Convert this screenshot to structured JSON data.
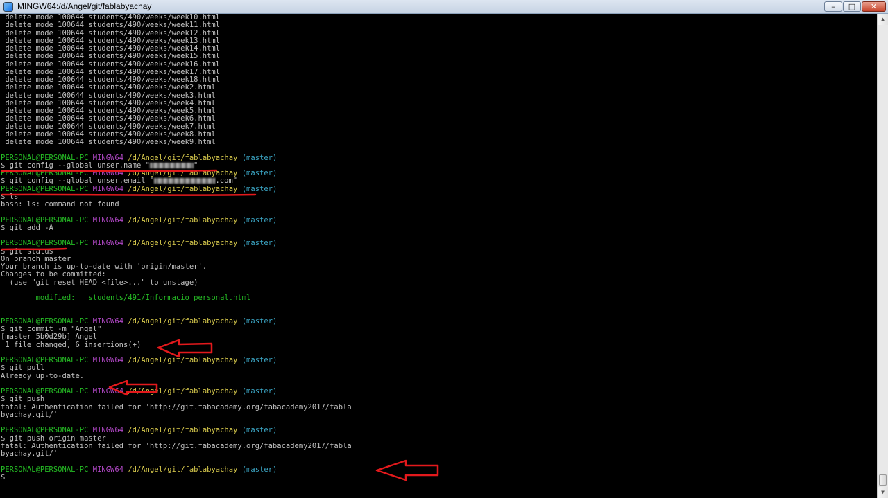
{
  "window": {
    "title": "MINGW64:/d/Angel/git/fablabyachay",
    "minimize_glyph": "–",
    "maximize_glyph": "□",
    "close_glyph": "✕"
  },
  "scrollbar": {
    "up_glyph": "▲",
    "down_glyph": "▼"
  },
  "prompt": {
    "user": "PERSONAL@PERSONAL-PC",
    "system": "MINGW64",
    "path": "/d/Angel/git/fablabyachay",
    "branch": "(master)"
  },
  "colors": {
    "user": "#25bc24",
    "system": "#b148c6",
    "path": "#d7c94c",
    "branch": "#3ba6c5",
    "annotation": "#e3191c"
  },
  "lines": [
    {
      "type": "text",
      "text": " delete mode 100644 students/490/weeks/week10.html"
    },
    {
      "type": "text",
      "text": " delete mode 100644 students/490/weeks/week11.html"
    },
    {
      "type": "text",
      "text": " delete mode 100644 students/490/weeks/week12.html"
    },
    {
      "type": "text",
      "text": " delete mode 100644 students/490/weeks/week13.html"
    },
    {
      "type": "text",
      "text": " delete mode 100644 students/490/weeks/week14.html"
    },
    {
      "type": "text",
      "text": " delete mode 100644 students/490/weeks/week15.html"
    },
    {
      "type": "text",
      "text": " delete mode 100644 students/490/weeks/week16.html"
    },
    {
      "type": "text",
      "text": " delete mode 100644 students/490/weeks/week17.html"
    },
    {
      "type": "text",
      "text": " delete mode 100644 students/490/weeks/week18.html"
    },
    {
      "type": "text",
      "text": " delete mode 100644 students/490/weeks/week2.html"
    },
    {
      "type": "text",
      "text": " delete mode 100644 students/490/weeks/week3.html"
    },
    {
      "type": "text",
      "text": " delete mode 100644 students/490/weeks/week4.html"
    },
    {
      "type": "text",
      "text": " delete mode 100644 students/490/weeks/week5.html"
    },
    {
      "type": "text",
      "text": " delete mode 100644 students/490/weeks/week6.html"
    },
    {
      "type": "text",
      "text": " delete mode 100644 students/490/weeks/week7.html"
    },
    {
      "type": "text",
      "text": " delete mode 100644 students/490/weeks/week8.html"
    },
    {
      "type": "text",
      "text": " delete mode 100644 students/490/weeks/week9.html"
    },
    {
      "type": "blank"
    },
    {
      "type": "prompt"
    },
    {
      "type": "redacted",
      "before": "$ git config --global unser.name \"",
      "blur_chars": 10,
      "after": "\""
    },
    {
      "type": "prompt"
    },
    {
      "type": "redacted",
      "before": "$ git config --global unser.email \"",
      "blur_chars": 14,
      "after": ".com\""
    },
    {
      "type": "prompt"
    },
    {
      "type": "text",
      "text": "$ ls"
    },
    {
      "type": "text",
      "text": "bash: ls: command not found"
    },
    {
      "type": "blank"
    },
    {
      "type": "prompt"
    },
    {
      "type": "text",
      "text": "$ git add -A"
    },
    {
      "type": "blank"
    },
    {
      "type": "prompt"
    },
    {
      "type": "text",
      "text": "$ git status"
    },
    {
      "type": "text",
      "text": "On branch master"
    },
    {
      "type": "text",
      "text": "Your branch is up-to-date with 'origin/master'."
    },
    {
      "type": "text",
      "text": "Changes to be committed:"
    },
    {
      "type": "text",
      "text": "  (use \"git reset HEAD <file>...\" to unstage)"
    },
    {
      "type": "blank"
    },
    {
      "type": "modified",
      "text": "        modified:   students/491/Informacio personal.html"
    },
    {
      "type": "blank"
    },
    {
      "type": "blank"
    },
    {
      "type": "prompt"
    },
    {
      "type": "text",
      "text": "$ git commit -m \"Angel\""
    },
    {
      "type": "text",
      "text": "[master 5b0d29b] Angel"
    },
    {
      "type": "text",
      "text": " 1 file changed, 6 insertions(+)"
    },
    {
      "type": "blank"
    },
    {
      "type": "prompt"
    },
    {
      "type": "text",
      "text": "$ git pull"
    },
    {
      "type": "text",
      "text": "Already up-to-date."
    },
    {
      "type": "blank"
    },
    {
      "type": "prompt"
    },
    {
      "type": "text",
      "text": "$ git push"
    },
    {
      "type": "text",
      "text": "fatal: Authentication failed for 'http://git.fabacademy.org/fabacademy2017/fabla"
    },
    {
      "type": "text",
      "text": "byachay.git/'"
    },
    {
      "type": "blank"
    },
    {
      "type": "prompt"
    },
    {
      "type": "text",
      "text": "$ git push origin master"
    },
    {
      "type": "text",
      "text": "fatal: Authentication failed for 'http://git.fabacademy.org/fabacademy2017/fabla"
    },
    {
      "type": "text",
      "text": "byachay.git/'"
    },
    {
      "type": "blank"
    },
    {
      "type": "prompt"
    },
    {
      "type": "text",
      "text": "$"
    }
  ]
}
